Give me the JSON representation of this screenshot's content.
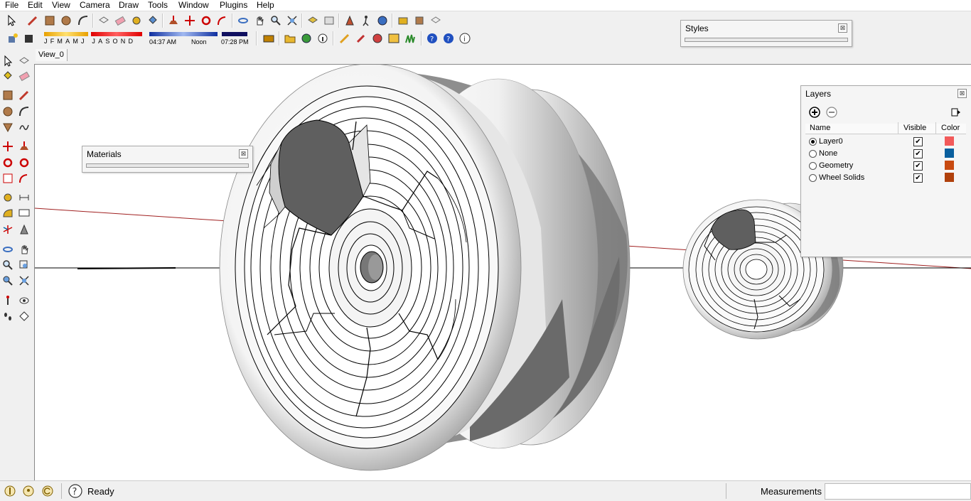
{
  "menu": [
    "File",
    "Edit",
    "View",
    "Camera",
    "Draw",
    "Tools",
    "Window",
    "Plugins",
    "Help"
  ],
  "shadows": {
    "months": [
      "J",
      "F",
      "M",
      "A",
      "M",
      "J",
      "J",
      "A",
      "S",
      "O",
      "N",
      "D"
    ],
    "time_start": "04:37 AM",
    "time_mid": "Noon",
    "time_end": "07:28 PM"
  },
  "tabs": [
    "View_0"
  ],
  "panels": {
    "styles": {
      "title": "Styles"
    },
    "materials": {
      "title": "Materials"
    },
    "layers": {
      "title": "Layers",
      "columns": {
        "name": "Name",
        "visible": "Visible",
        "color": "Color"
      },
      "rows": [
        {
          "name": "Layer0",
          "active": true,
          "visible": true,
          "color": "#f25a5a"
        },
        {
          "name": "None",
          "active": false,
          "visible": true,
          "color": "#0a5f9e"
        },
        {
          "name": "Geometry",
          "active": false,
          "visible": true,
          "color": "#c84a10"
        },
        {
          "name": "Wheel Solids",
          "active": false,
          "visible": true,
          "color": "#b0400c"
        }
      ]
    }
  },
  "status": {
    "text": "Ready",
    "measurements_label": "Measurements",
    "measurements_value": ""
  },
  "icons": {
    "close": "close-icon",
    "add_layer": "add-layer-icon",
    "remove_layer": "remove-layer-icon",
    "details": "details-icon",
    "help": "help-icon"
  }
}
